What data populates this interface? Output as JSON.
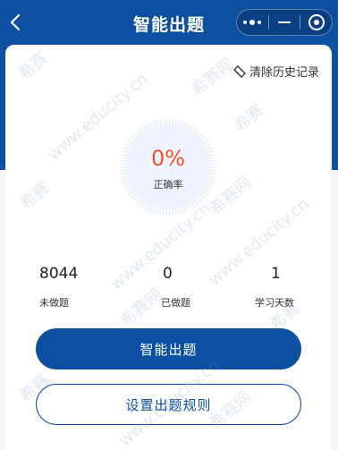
{
  "nav": {
    "title": "智能出题",
    "back_icon": "chevron-left-icon",
    "menu_icon": "more-dots-icon",
    "minimize_icon": "minimize-icon",
    "close_icon": "target-close-icon"
  },
  "toolbar": {
    "clear_history_label": "清除历史记录",
    "clear_history_icon": "eraser-icon"
  },
  "accuracy": {
    "value": "0%",
    "label": "正确率"
  },
  "stats": [
    {
      "value": "8044",
      "label": "未做题"
    },
    {
      "value": "0",
      "label": "已做题"
    },
    {
      "value": "1",
      "label": "学习天数"
    }
  ],
  "actions": {
    "primary_label": "智能出题",
    "secondary_label": "设置出题规则"
  },
  "watermark": {
    "cn": "希赛",
    "cn_alt": "希赛网",
    "url": "www.educity.cn"
  },
  "colors": {
    "brand_blue": "#0d4fa0",
    "accent_orange": "#f0522d"
  }
}
